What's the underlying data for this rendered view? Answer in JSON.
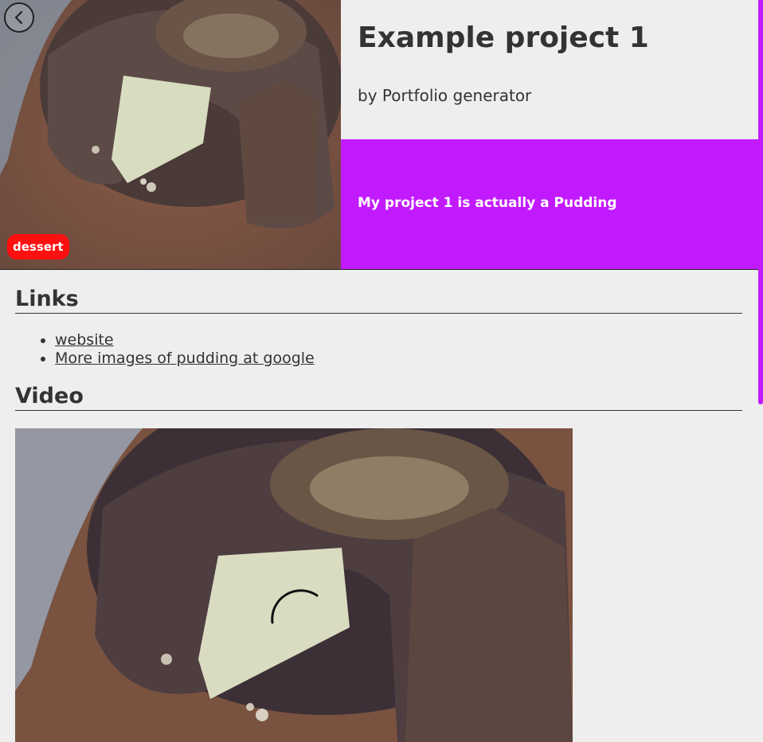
{
  "project": {
    "title": "Example project 1",
    "author": "by Portfolio generator",
    "description": "My project 1 is actually a Pudding",
    "tag": "dessert"
  },
  "links": {
    "heading": "Links",
    "items": [
      {
        "label": "website"
      },
      {
        "label": "More images of pudding at google"
      }
    ]
  },
  "video": {
    "heading": "Video"
  },
  "icons": {
    "back": "chevron-left-icon",
    "loading": "loading-spinner-icon"
  },
  "colors": {
    "accent": "#c21aff",
    "tag": "#ff0f0f",
    "background": "#eeeeee",
    "text": "#333333"
  }
}
